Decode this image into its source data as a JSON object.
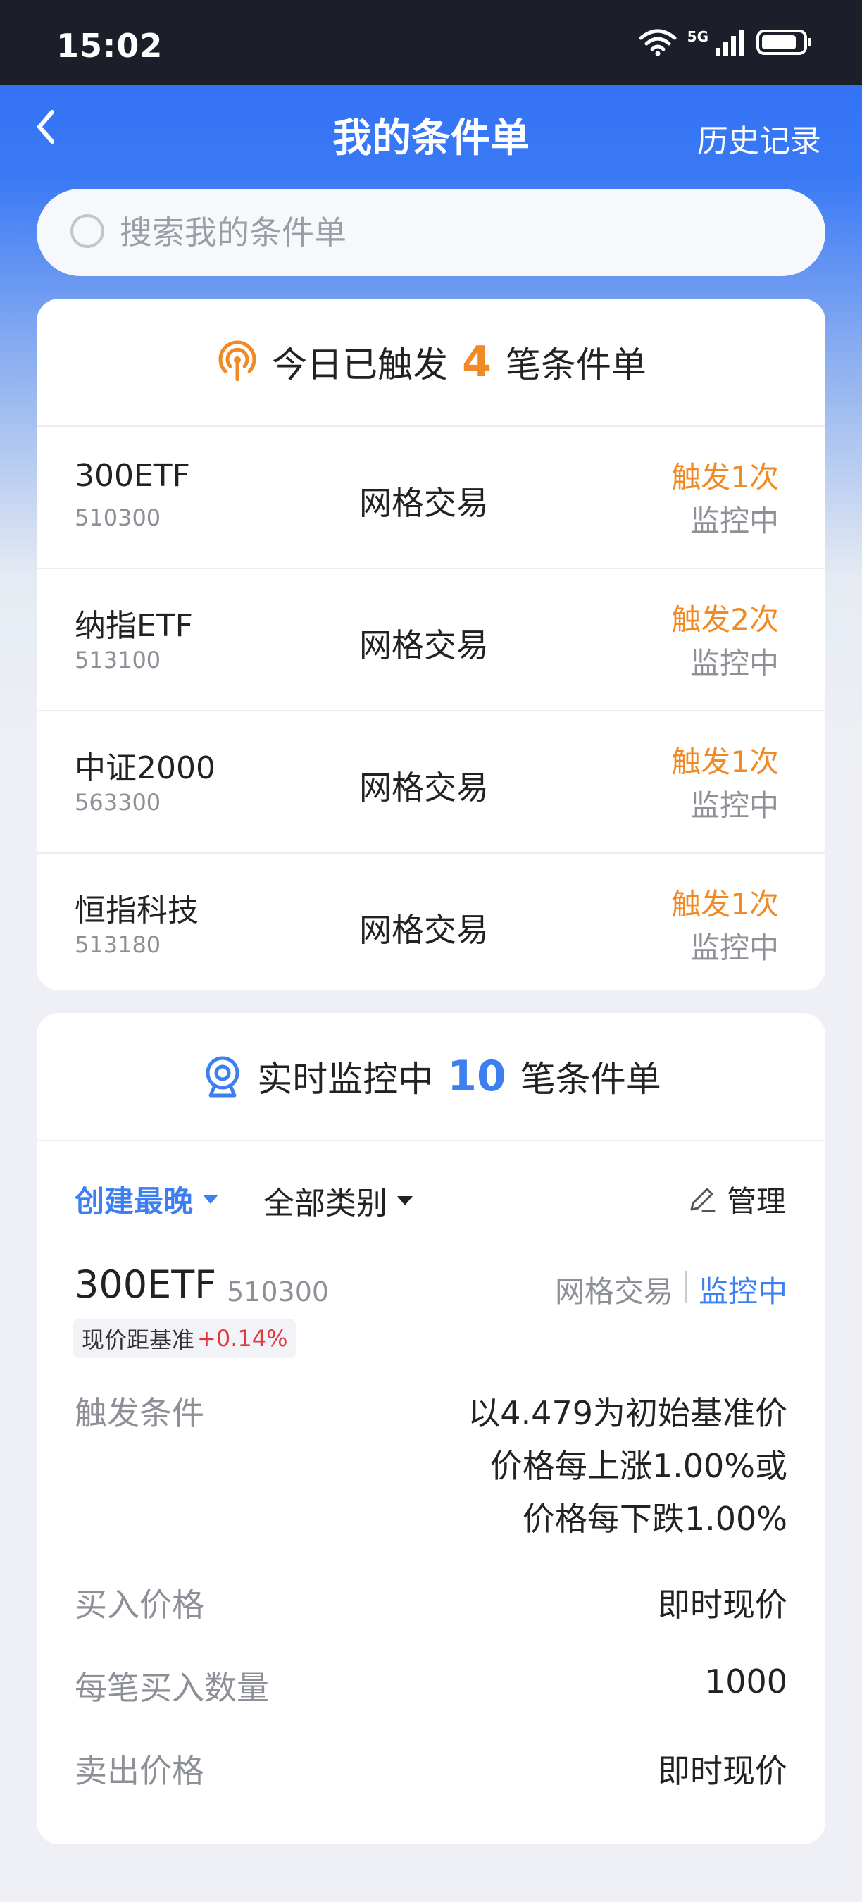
{
  "status_bar": {
    "time": "15:02",
    "network_label": "5G"
  },
  "header": {
    "title": "我的条件单",
    "history": "历史记录"
  },
  "search": {
    "placeholder": "搜索我的条件单"
  },
  "triggered": {
    "prefix": "今日已触发",
    "count": "4",
    "suffix": "笔条件单",
    "items": [
      {
        "name": "300ETF",
        "code": "510300",
        "type": "网格交易",
        "times": "触发1次",
        "status": "监控中"
      },
      {
        "name": "纳指ETF",
        "code": "513100",
        "type": "网格交易",
        "times": "触发2次",
        "status": "监控中"
      },
      {
        "name": "中证2000",
        "code": "563300",
        "type": "网格交易",
        "times": "触发1次",
        "status": "监控中"
      },
      {
        "name": "恒指科技",
        "code": "513180",
        "type": "网格交易",
        "times": "触发1次",
        "status": "监控中"
      }
    ]
  },
  "monitoring": {
    "prefix": "实时监控中",
    "count": "10",
    "suffix": "笔条件单",
    "filter": {
      "sort": "创建最晚",
      "category": "全部类别",
      "manage": "管理"
    },
    "order": {
      "name": "300ETF",
      "code": "510300",
      "type": "网格交易",
      "status": "监控中",
      "badge_label": "现价距基准",
      "badge_value": "+0.14%",
      "details": [
        {
          "key": "触发条件",
          "lines": [
            "以4.479为初始基准价",
            "价格每上涨1.00%或",
            "价格每下跌1.00%"
          ]
        },
        {
          "key": "买入价格",
          "value": "即时现价"
        },
        {
          "key": "每笔买入数量",
          "value": "1000"
        },
        {
          "key": "卖出价格",
          "value": "即时现价"
        }
      ]
    }
  },
  "colors": {
    "brand_blue": "#3d7ff0",
    "trigger_orange": "#f08a24",
    "up_red": "#e0363e"
  }
}
